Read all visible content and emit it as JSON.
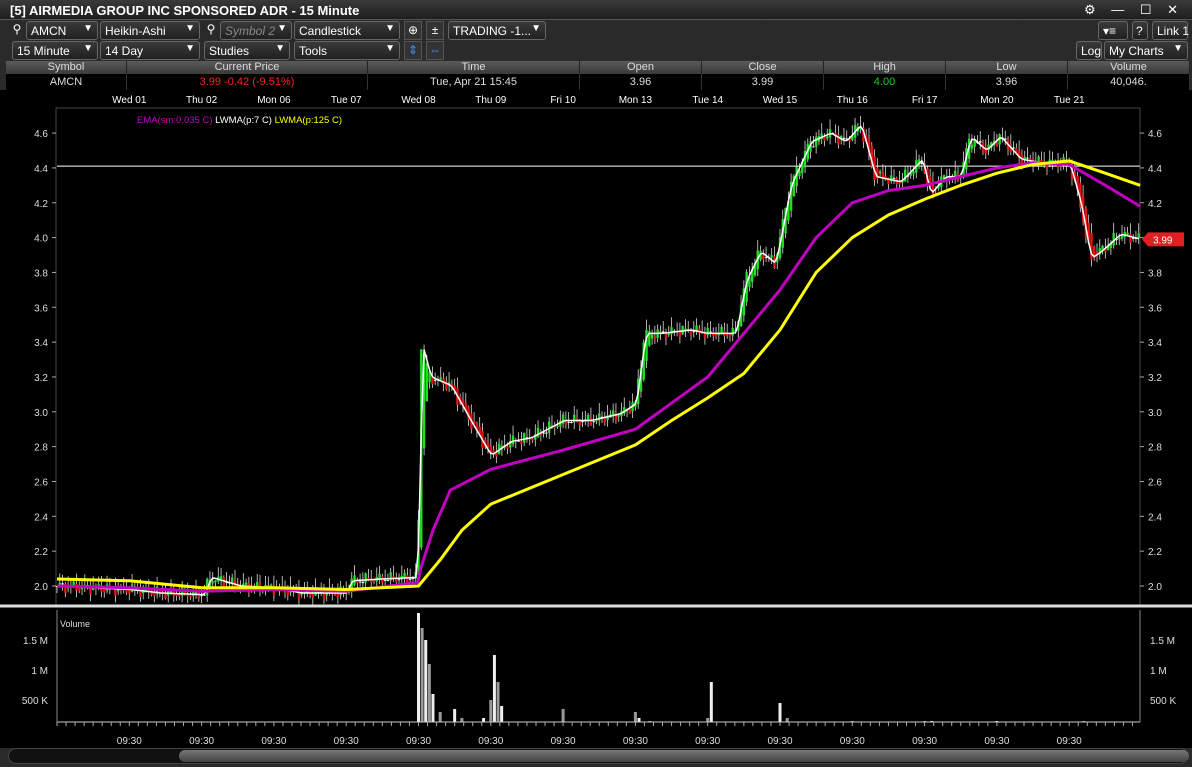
{
  "window": {
    "title": "[5] AIRMEDIA GROUP INC SPONSORED ADR - 15 Minute"
  },
  "toolbar": {
    "symbol": "AMCN",
    "chart_style": "Heikin-Ashi",
    "symbol2_placeholder": "Symbol 2",
    "chart_type": "Candlestick",
    "layout": "TRADING -1...",
    "interval": "15 Minute",
    "range": "14 Day",
    "studies": "Studies",
    "tools": "Tools",
    "log": "Log",
    "my_charts": "My Charts",
    "help": "?",
    "link": "Link 1"
  },
  "quote": {
    "headers": [
      "Symbol",
      "Current Price",
      "Time",
      "Open",
      "Close",
      "High",
      "Low",
      "Volume"
    ],
    "symbol": "AMCN",
    "current_price": "3.99  -0.42 (-9.51%)",
    "time": "Tue, Apr 21  15:45",
    "open": "3.96",
    "close": "3.99",
    "high": "4.00",
    "low": "3.96",
    "volume": "40,046."
  },
  "colors": {
    "up": "#22dd22",
    "down": "#ee1111",
    "ema": "#c000c0",
    "lwma7": "#ffffff",
    "lwma125": "#ffff00",
    "high_value": "#22cc22",
    "price_down": "#ff2020"
  },
  "chart_data": {
    "type": "line",
    "title": "AMCN 15 Minute Heikin-Ashi",
    "date_labels": [
      "Wed 01",
      "Thu 02",
      "Mon 06",
      "Tue 07",
      "Wed 08",
      "Thu 09",
      "Fri 10",
      "Mon 13",
      "Tue 14",
      "Wed 15",
      "Thu 16",
      "Fri 17",
      "Mon 20",
      "Tue 21"
    ],
    "time_label": "09:30",
    "price_ticks": [
      "2.0",
      "2.2",
      "2.4",
      "2.6",
      "2.8",
      "3.0",
      "3.2",
      "3.4",
      "3.6",
      "3.8",
      "4.0",
      "4.2",
      "4.4",
      "4.6"
    ],
    "ylim": [
      1.9,
      4.75
    ],
    "xlim_days": [
      0,
      15
    ],
    "horizontal_line": 4.41,
    "last_price_label": "3.99",
    "legend": [
      "EMA(sm:0.035 C)",
      "LWMA(p:7 C)",
      "LWMA(p:125 C)"
    ],
    "price_path": [
      [
        0,
        2.0
      ],
      [
        1,
        1.98
      ],
      [
        1.42,
        1.96
      ],
      [
        2.03,
        1.95
      ],
      [
        2.12,
        2.05
      ],
      [
        2.53,
        2.0
      ],
      [
        3,
        1.99
      ],
      [
        3.36,
        1.96
      ],
      [
        4.01,
        1.96
      ],
      [
        4.05,
        2.03
      ],
      [
        4.47,
        2.04
      ],
      [
        4.99,
        2.05
      ],
      [
        5.03,
        3.4
      ],
      [
        5.16,
        3.2
      ],
      [
        5.44,
        3.15
      ],
      [
        5.71,
        2.95
      ],
      [
        5.99,
        2.75
      ],
      [
        6.27,
        2.83
      ],
      [
        6.54,
        2.85
      ],
      [
        7,
        2.95
      ],
      [
        7.37,
        2.95
      ],
      [
        7.79,
        2.99
      ],
      [
        8,
        3.05
      ],
      [
        8.13,
        3.45
      ],
      [
        8.34,
        3.45
      ],
      [
        8.76,
        3.47
      ],
      [
        8.98,
        3.45
      ],
      [
        9.38,
        3.45
      ],
      [
        9.52,
        3.75
      ],
      [
        9.72,
        3.92
      ],
      [
        9.93,
        3.85
      ],
      [
        10,
        4.0
      ],
      [
        10.14,
        4.3
      ],
      [
        10.42,
        4.55
      ],
      [
        10.69,
        4.6
      ],
      [
        10.9,
        4.55
      ],
      [
        11.11,
        4.65
      ],
      [
        11.31,
        4.35
      ],
      [
        11.66,
        4.32
      ],
      [
        11.96,
        4.45
      ],
      [
        12.07,
        4.25
      ],
      [
        12.28,
        4.35
      ],
      [
        12.49,
        4.35
      ],
      [
        12.63,
        4.58
      ],
      [
        12.84,
        4.5
      ],
      [
        13.04,
        4.58
      ],
      [
        13.32,
        4.45
      ],
      [
        13.6,
        4.43
      ],
      [
        14,
        4.42
      ],
      [
        14.15,
        4.2
      ],
      [
        14.29,
        3.88
      ],
      [
        14.43,
        3.92
      ],
      [
        14.7,
        4.02
      ],
      [
        14.98,
        3.99
      ]
    ],
    "series": [
      {
        "name": "EMA(sm:0.035 C)",
        "points": [
          [
            0,
            2.0
          ],
          [
            1,
            1.99
          ],
          [
            2,
            1.97
          ],
          [
            3,
            1.98
          ],
          [
            4,
            1.97
          ],
          [
            4.99,
            2.02
          ],
          [
            5.03,
            2.1
          ],
          [
            5.2,
            2.32
          ],
          [
            5.44,
            2.55
          ],
          [
            6,
            2.67
          ],
          [
            7,
            2.78
          ],
          [
            8,
            2.9
          ],
          [
            8.5,
            3.05
          ],
          [
            9,
            3.2
          ],
          [
            9.5,
            3.45
          ],
          [
            10,
            3.7
          ],
          [
            10.5,
            4.0
          ],
          [
            11,
            4.2
          ],
          [
            11.5,
            4.27
          ],
          [
            12,
            4.3
          ],
          [
            12.5,
            4.35
          ],
          [
            13,
            4.4
          ],
          [
            13.5,
            4.43
          ],
          [
            14,
            4.42
          ],
          [
            14.5,
            4.3
          ],
          [
            14.98,
            4.18
          ]
        ]
      },
      {
        "name": "LWMA(p:125 C)",
        "points": [
          [
            0,
            2.04
          ],
          [
            1,
            2.03
          ],
          [
            2,
            1.99
          ],
          [
            3,
            1.99
          ],
          [
            4,
            1.98
          ],
          [
            5,
            2.0
          ],
          [
            5.3,
            2.15
          ],
          [
            5.6,
            2.32
          ],
          [
            6,
            2.47
          ],
          [
            7,
            2.64
          ],
          [
            8,
            2.81
          ],
          [
            8.5,
            2.95
          ],
          [
            9,
            3.08
          ],
          [
            9.5,
            3.22
          ],
          [
            10,
            3.47
          ],
          [
            10.5,
            3.8
          ],
          [
            11,
            4.0
          ],
          [
            11.5,
            4.13
          ],
          [
            12,
            4.22
          ],
          [
            12.5,
            4.3
          ],
          [
            13,
            4.37
          ],
          [
            13.5,
            4.42
          ],
          [
            14,
            4.44
          ],
          [
            14.5,
            4.37
          ],
          [
            14.98,
            4.3
          ]
        ]
      }
    ],
    "volume": {
      "label": "Volume",
      "ticks": [
        "500 K",
        "1 M",
        "1.5 M"
      ],
      "bars": [
        [
          2.0,
          0.08
        ],
        [
          3.05,
          0.1
        ],
        [
          4.0,
          0.05
        ],
        [
          4.6,
          0.05
        ],
        [
          5.0,
          1.95
        ],
        [
          5.05,
          1.7
        ],
        [
          5.1,
          1.5
        ],
        [
          5.15,
          1.1
        ],
        [
          5.2,
          0.6
        ],
        [
          5.3,
          0.3
        ],
        [
          5.5,
          0.35
        ],
        [
          5.6,
          0.2
        ],
        [
          5.9,
          0.2
        ],
        [
          6.0,
          0.5
        ],
        [
          6.05,
          1.25
        ],
        [
          6.1,
          0.8
        ],
        [
          6.15,
          0.4
        ],
        [
          7.0,
          0.35
        ],
        [
          7.2,
          0.08
        ],
        [
          8.0,
          0.3
        ],
        [
          8.05,
          0.2
        ],
        [
          8.2,
          0.15
        ],
        [
          8.4,
          0.1
        ],
        [
          9.0,
          0.2
        ],
        [
          9.05,
          0.8
        ],
        [
          9.1,
          0.1
        ],
        [
          10.0,
          0.45
        ],
        [
          10.1,
          0.2
        ],
        [
          10.3,
          0.1
        ],
        [
          11.0,
          0.15
        ],
        [
          11.05,
          0.1
        ],
        [
          12.0,
          0.15
        ],
        [
          12.1,
          0.15
        ],
        [
          12.6,
          0.1
        ],
        [
          13.0,
          0.15
        ],
        [
          13.4,
          0.05
        ],
        [
          14.0,
          0.1
        ],
        [
          14.2,
          0.15
        ],
        [
          14.3,
          0.1
        ]
      ]
    }
  }
}
